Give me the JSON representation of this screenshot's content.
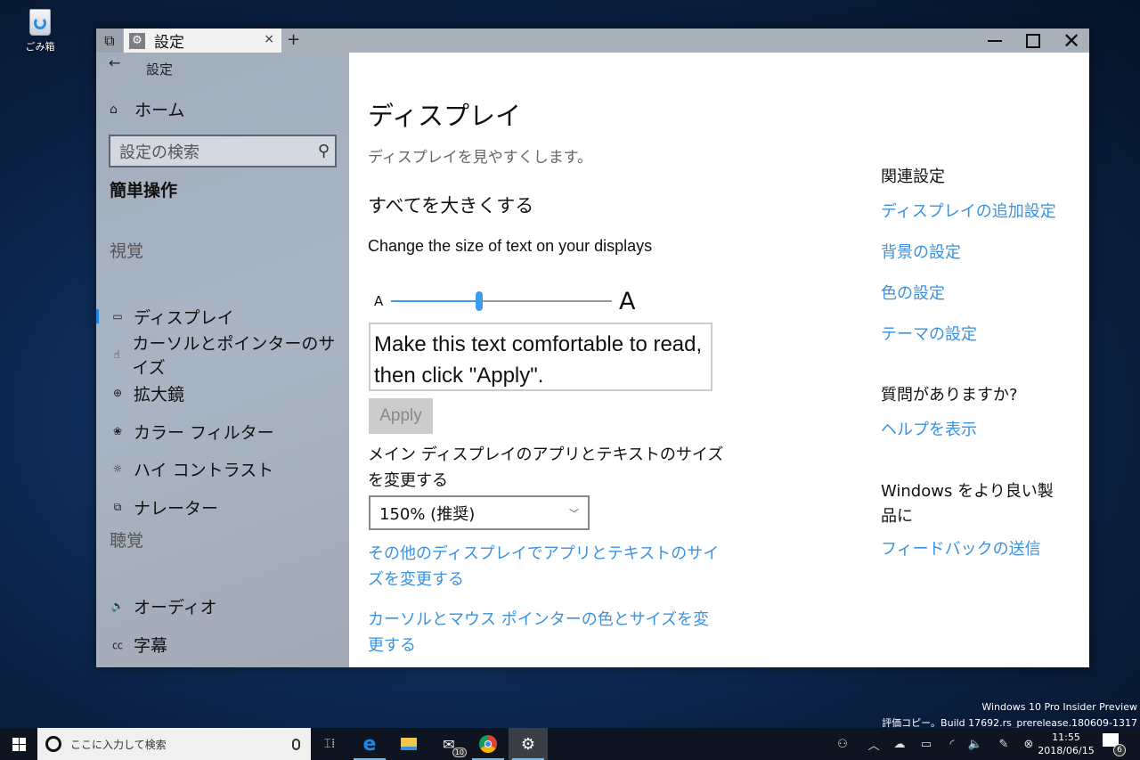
{
  "desktop": {
    "recycle_bin_label": "ごみ箱"
  },
  "window": {
    "tab_title": "設定",
    "tab_close": "×",
    "new_tab": "+",
    "controls": {
      "minimize": "minimize",
      "maximize": "maximize",
      "close": "✕"
    }
  },
  "sidebar": {
    "back": "←",
    "title": "設定",
    "home": "ホーム",
    "search_placeholder": "設定の検索",
    "category": "簡単操作",
    "groups": [
      {
        "label": "視覚",
        "items": [
          {
            "label": "ディスプレイ",
            "icon": "monitor-icon",
            "glyph": "▭",
            "active": true
          },
          {
            "label": "カーソルとポインターのサイズ",
            "icon": "pointer-icon",
            "glyph": "☝",
            "active": false
          },
          {
            "label": "拡大鏡",
            "icon": "magnifier-icon",
            "glyph": "⊕",
            "active": false
          },
          {
            "label": "カラー フィルター",
            "icon": "palette-icon",
            "glyph": "❀",
            "active": false
          },
          {
            "label": "ハイ コントラスト",
            "icon": "contrast-icon",
            "glyph": "☼",
            "active": false
          },
          {
            "label": "ナレーター",
            "icon": "narrator-icon",
            "glyph": "⧉",
            "active": false
          }
        ]
      },
      {
        "label": "聴覚",
        "items": [
          {
            "label": "オーディオ",
            "icon": "speaker-icon",
            "glyph": "🔈",
            "active": false
          },
          {
            "label": "字幕",
            "icon": "cc-icon",
            "glyph": "㏄",
            "active": false
          }
        ]
      }
    ]
  },
  "main": {
    "title": "ディスプレイ",
    "subtitle": "ディスプレイを見やすくします。",
    "section_title": "すべてを大きくする",
    "text_size_label": "Change the size of text on your displays",
    "slider_small": "A",
    "slider_big": "A",
    "text_size_percent": 40,
    "preview_text": "Make this text comfortable to read, then click \"Apply\".",
    "apply_button": "Apply",
    "scale_label": "メイン ディスプレイのアプリとテキストのサイズを変更する",
    "scale_value": "150% (推奨)",
    "links": [
      "その他のディスプレイでアプリとテキストのサイズを変更する",
      "カーソルとマウス ポインターの色とサイズを変更する"
    ]
  },
  "related": {
    "heading": "関連設定",
    "links": [
      "ディスプレイの追加設定",
      "背景の設定",
      "色の設定",
      "テーマの設定"
    ],
    "question_heading": "質問がありますか?",
    "help_link": "ヘルプを表示",
    "feedback_heading": "Windows をより良い製品に",
    "feedback_link": "フィードバックの送信"
  },
  "watermark": {
    "line1": "Windows 10 Pro Insider Preview",
    "line2": "評価コピー。Build 17692.rs_prerelease.180609-1317"
  },
  "taskbar": {
    "search_placeholder": "ここに入力して検索",
    "mail_badge": "10",
    "time": "11:55",
    "date": "2018/06/15",
    "notification_count": "6"
  },
  "colors": {
    "accent": "#3b9cf2",
    "link": "#3a92e0"
  }
}
